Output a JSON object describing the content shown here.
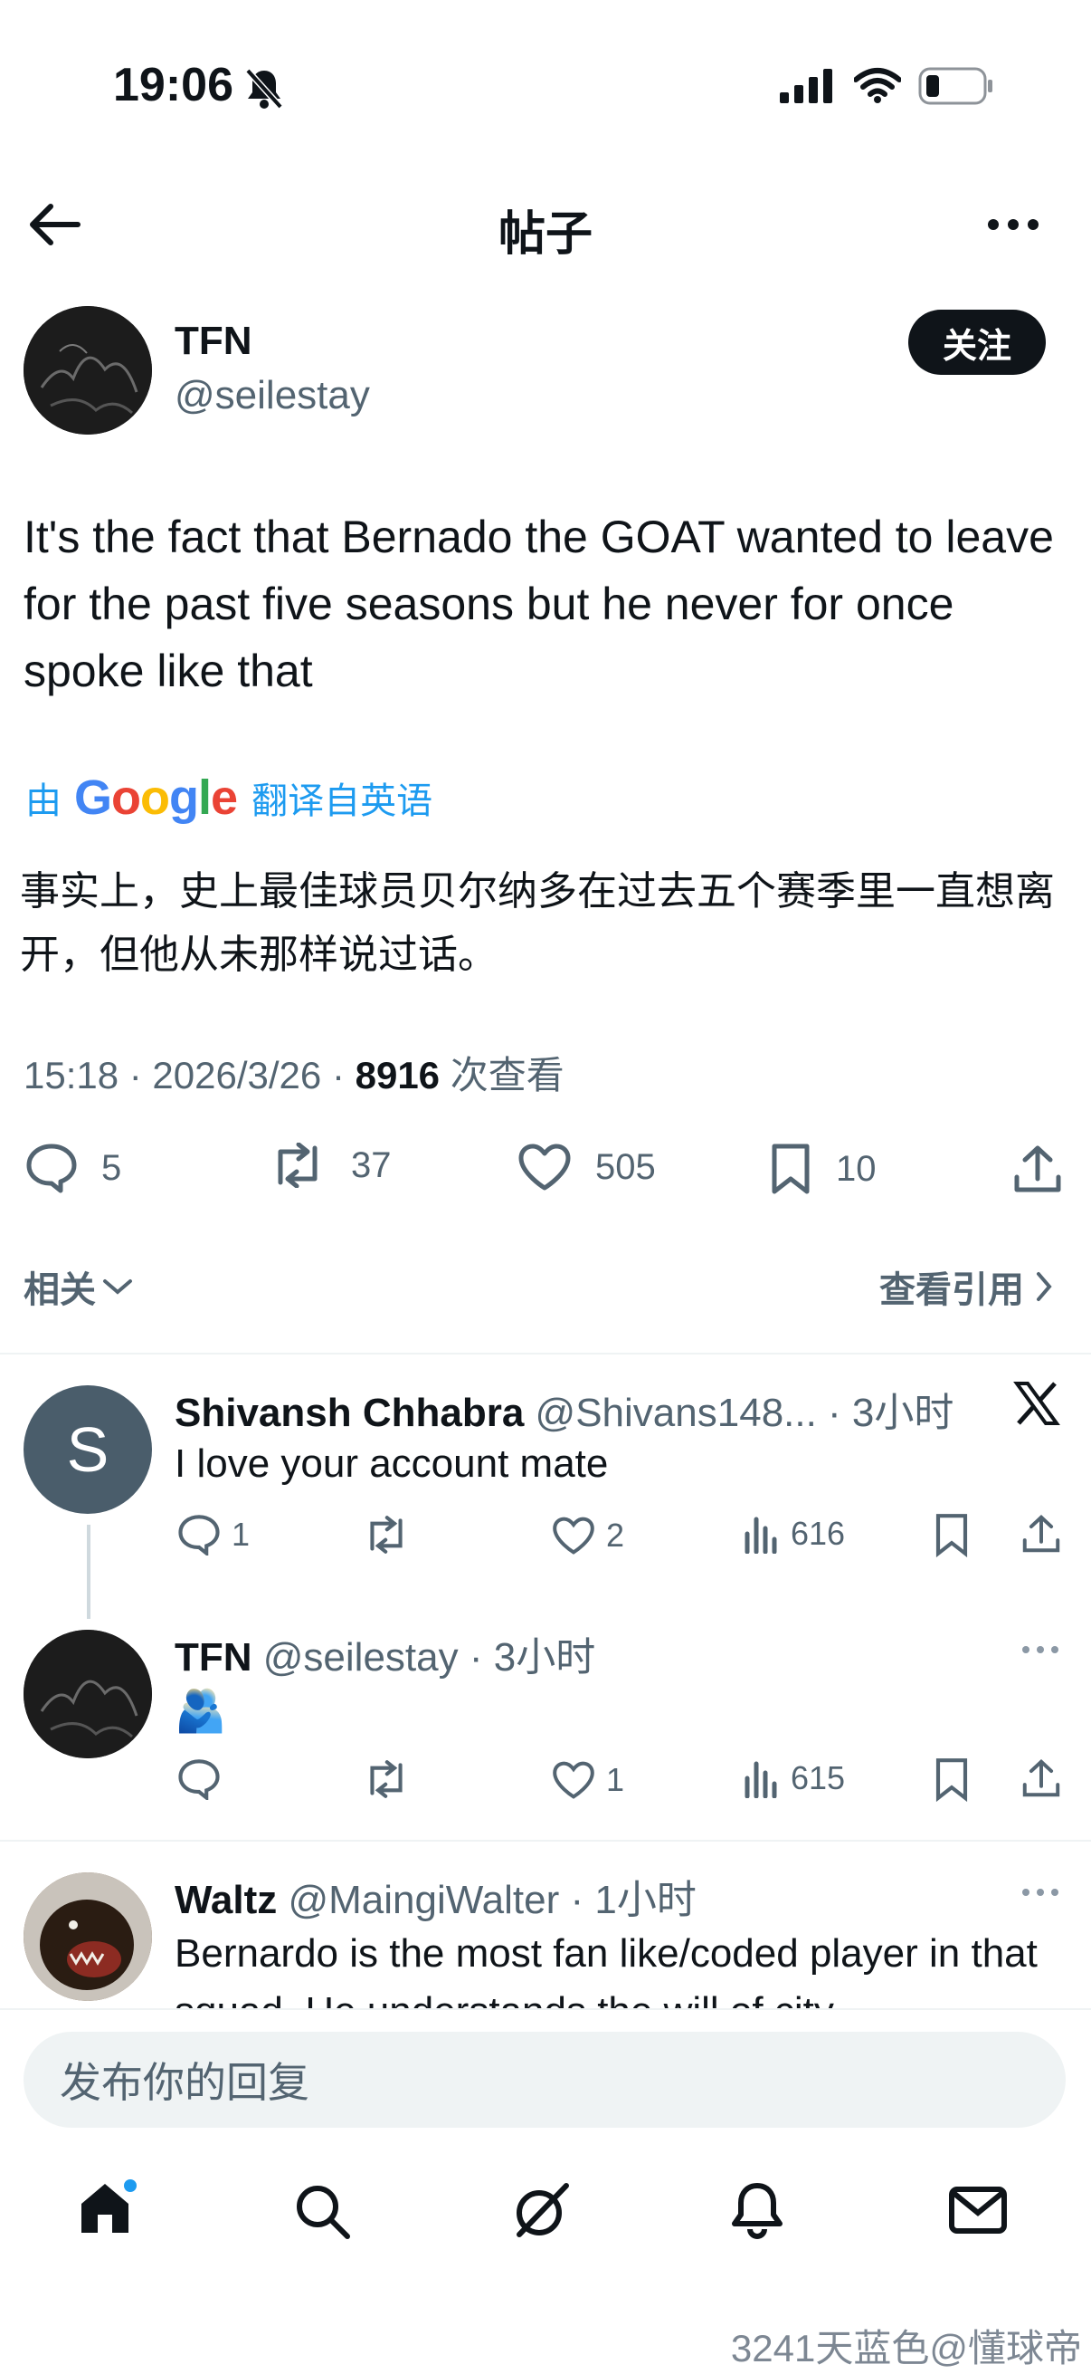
{
  "status": {
    "time": "19:06"
  },
  "header": {
    "title": "帖子"
  },
  "post": {
    "author": {
      "name": "TFN",
      "handle": "@seilestay"
    },
    "follow_label": "关注",
    "text": "It's the fact that Bernado the GOAT wanted to leave for the past five seasons but he never for once spoke like that",
    "translate": {
      "by": "由",
      "brand": "Google",
      "label": "翻译自英语"
    },
    "translated_text": "事实上，史上最佳球员贝尔纳多在过去五个赛季里一直想离开，但他从未那样说过话。",
    "time": "15:18 · 2026/3/26 · ",
    "views": "8916",
    "views_label": " 次查看",
    "actions": {
      "replies": "5",
      "reposts": "37",
      "likes": "505",
      "bookmarks": "10"
    },
    "related_label": "相关",
    "quotes_label": "查看引用"
  },
  "replies": [
    {
      "name": "Shivansh Chhabra",
      "handle": "@Shivans148... · 3小时",
      "avatar_letter": "S",
      "text": "I love your account mate",
      "replies": "1",
      "likes": "2",
      "views": "616"
    },
    {
      "name": "TFN",
      "handle": "@seilestay · 3小时",
      "text": "🫂",
      "replies": "",
      "likes": "1",
      "views": "615"
    },
    {
      "name": "Waltz",
      "handle": "@MaingiWalter · 1小时",
      "text": "Bernardo is the most fan like/coded player in that squad. He understands the will of city"
    }
  ],
  "composer": {
    "placeholder": "发布你的回复"
  },
  "watermark": "3241天蓝色@懂球帝"
}
